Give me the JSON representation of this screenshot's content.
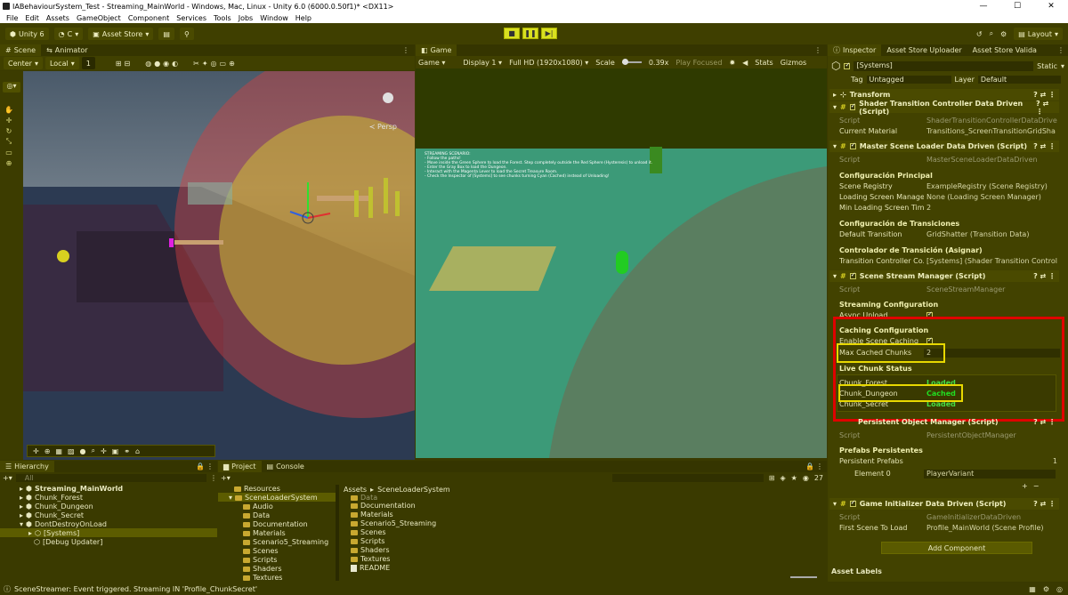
{
  "window": {
    "title": "IABehaviourSystem_Test - Streaming_MainWorld - Windows, Mac, Linux - Unity 6.0 (6000.0.50f1)* <DX11>"
  },
  "menu": [
    "File",
    "Edit",
    "Assets",
    "GameObject",
    "Component",
    "Services",
    "Tools",
    "Jobs",
    "Window",
    "Help"
  ],
  "toolbar": {
    "unity_label": "Unity 6",
    "account_label": "C",
    "asset_store_label": "Asset Store",
    "layout_label": "Layout"
  },
  "scene_panel": {
    "tabs": [
      "Scene",
      "Animator"
    ],
    "pivot": "Center",
    "space": "Local",
    "grid_value": "1",
    "persp_label": "≺ Persp"
  },
  "game_panel": {
    "tab": "Game",
    "mode": "Game",
    "display": "Display 1",
    "resolution": "Full HD (1920x1080)",
    "scale_label": "Scale",
    "scale_value": "0.39x",
    "play_mode": "Play Focused",
    "stats_label": "Stats",
    "gizmos_label": "Gizmos",
    "overlay": [
      "STREAMING SCENARIO:",
      "- Follow the paths!",
      "- Move inside the Green Sphere to load the Forest. Step completely outside the Red Sphere (Hysteresis) to unload it.",
      "- Enter the Gray Box to load the Dungeon.",
      "- Interact with the Magenta Lever to load the Secret Treasure Room.",
      "- Check the Inspector of [Systems] to see chunks turning Cyan (Cached) instead of Unloading!"
    ]
  },
  "inspector": {
    "tabs": [
      "Inspector",
      "Asset Store Uploader",
      "Asset Store Valida"
    ],
    "object_name": "[Systems]",
    "static_label": "Static",
    "tag_label": "Tag",
    "tag_value": "Untagged",
    "layer_label": "Layer",
    "layer_value": "Default",
    "transform_label": "Transform",
    "shader_comp": {
      "title": "Shader Transition Controller Data Driven (Script)",
      "script_label": "Script",
      "script_value": "ShaderTransitionControllerDataDrive",
      "material_label": "Current Material",
      "material_value": "Transitions_ScreenTransitionGridSha"
    },
    "master_comp": {
      "title": "Master Scene Loader Data Driven (Script)",
      "script_label": "Script",
      "script_value": "MasterSceneLoaderDataDriven",
      "section1": "Configuración Principal",
      "registry_label": "Scene Registry",
      "registry_value": "ExampleRegistry (Scene Registry)",
      "loading_label": "Loading Screen Manager",
      "loading_value": "None (Loading Screen Manager)",
      "min_label": "Min Loading Screen Time",
      "min_value": "2",
      "section2": "Configuración de Transiciones",
      "default_label": "Default Transition",
      "default_value": "GridShatter (Transition Data)",
      "section3": "Controlador de Transición (Asignar)",
      "controller_label": "Transition Controller Co...",
      "controller_value": "[Systems] (Shader Transition Control"
    },
    "stream_comp": {
      "title": "Scene Stream Manager (Script)",
      "script_label": "Script",
      "script_value": "SceneStreamManager",
      "section1": "Streaming Configuration",
      "async_label": "Async Unload",
      "section2": "Caching Configuration",
      "enable_label": "Enable Scene Caching",
      "max_label": "Max Cached Chunks",
      "max_value": "2",
      "section3": "Live Chunk Status",
      "chunks": [
        {
          "name": "Chunk_Forest",
          "status": "Loaded"
        },
        {
          "name": "Chunk_Dungeon",
          "status": "Cached"
        },
        {
          "name": "Chunk_Secret",
          "status": "Loaded"
        }
      ]
    },
    "persist_comp": {
      "title": "Persistent Object Manager (Script)",
      "script_label": "Script",
      "script_value": "PersistentObjectManager",
      "section": "Prefabs Persistentes",
      "list_label": "Persistent Prefabs",
      "list_count": "1",
      "element_label": "Element 0",
      "element_value": "PlayerVariant",
      "plus": "+",
      "minus": "−"
    },
    "init_comp": {
      "title": "Game Initializer Data Driven (Script)",
      "script_label": "Script",
      "script_value": "GameInitializerDataDriven",
      "first_label": "First Scene To Load",
      "first_value": "Profile_MainWorld (Scene Profile)"
    },
    "add_component": "Add Component",
    "asset_labels": "Asset Labels"
  },
  "hierarchy": {
    "tab": "Hierarchy",
    "search_placeholder": "All",
    "items": [
      "Streaming_MainWorld",
      "Chunk_Forest",
      "Chunk_Dungeon",
      "Chunk_Secret",
      "DontDestroyOnLoad",
      "[Systems]",
      "[Debug Updater]"
    ]
  },
  "project": {
    "tabs": [
      "Project",
      "Console"
    ],
    "tree": [
      "Resources",
      "SceneLoaderSystem",
      "Audio",
      "Data",
      "Documentation",
      "Materials",
      "Scenario5_Streaming",
      "Scenes",
      "Scripts",
      "Shaders",
      "Textures"
    ],
    "breadcrumb": [
      "Assets",
      "SceneLoaderSystem"
    ],
    "files": [
      "Data",
      "Documentation",
      "Materials",
      "Scenario5_Streaming",
      "Scenes",
      "Scripts",
      "Shaders",
      "Textures",
      "README"
    ],
    "count_label": "27"
  },
  "status_bar": {
    "message": "SceneStreamer: Event triggered. Streaming IN 'Profile_ChunkSecret'"
  },
  "colors": {
    "accent": "#d9e020",
    "loaded": "#44dd44",
    "cached": "#22dd22",
    "highlight": "#e8d800",
    "alert": "#e00000"
  }
}
